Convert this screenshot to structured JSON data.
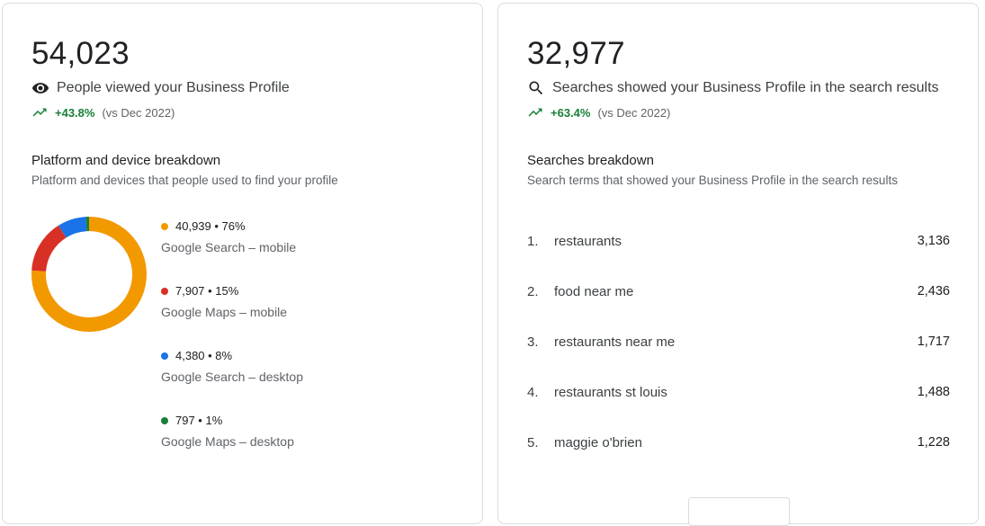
{
  "views_card": {
    "total": "54,023",
    "metric_label": "People viewed your Business Profile",
    "change_pct": "+43.8%",
    "change_vs": "(vs Dec 2022)",
    "section_title": "Platform and device breakdown",
    "section_subtitle": "Platform and devices that people used to find your profile",
    "breakdown": [
      {
        "value": "40,939 • 76%",
        "label": "Google Search – mobile",
        "color": "#f29900",
        "share": 0.76
      },
      {
        "value": "7,907 • 15%",
        "label": "Google Maps – mobile",
        "color": "#d93025",
        "share": 0.15
      },
      {
        "value": "4,380 • 8%",
        "label": "Google Search – desktop",
        "color": "#1a73e8",
        "share": 0.08
      },
      {
        "value": "797 • 1%",
        "label": "Google Maps – desktop",
        "color": "#188038",
        "share": 0.01
      }
    ]
  },
  "searches_card": {
    "total": "32,977",
    "metric_label": "Searches showed your Business Profile in the search results",
    "change_pct": "+63.4%",
    "change_vs": "(vs Dec 2022)",
    "section_title": "Searches breakdown",
    "section_subtitle": "Search terms that showed your Business Profile in the search results",
    "terms": [
      {
        "rank": "1.",
        "term": "restaurants",
        "count": "3,136"
      },
      {
        "rank": "2.",
        "term": "food near me",
        "count": "2,436"
      },
      {
        "rank": "3.",
        "term": "restaurants near me",
        "count": "1,717"
      },
      {
        "rank": "4.",
        "term": "restaurants st louis",
        "count": "1,488"
      },
      {
        "rank": "5.",
        "term": "maggie o'brien",
        "count": "1,228"
      }
    ]
  },
  "icons": {
    "views": "eye-icon",
    "searches": "search-icon",
    "trend": "trending-up-icon"
  }
}
